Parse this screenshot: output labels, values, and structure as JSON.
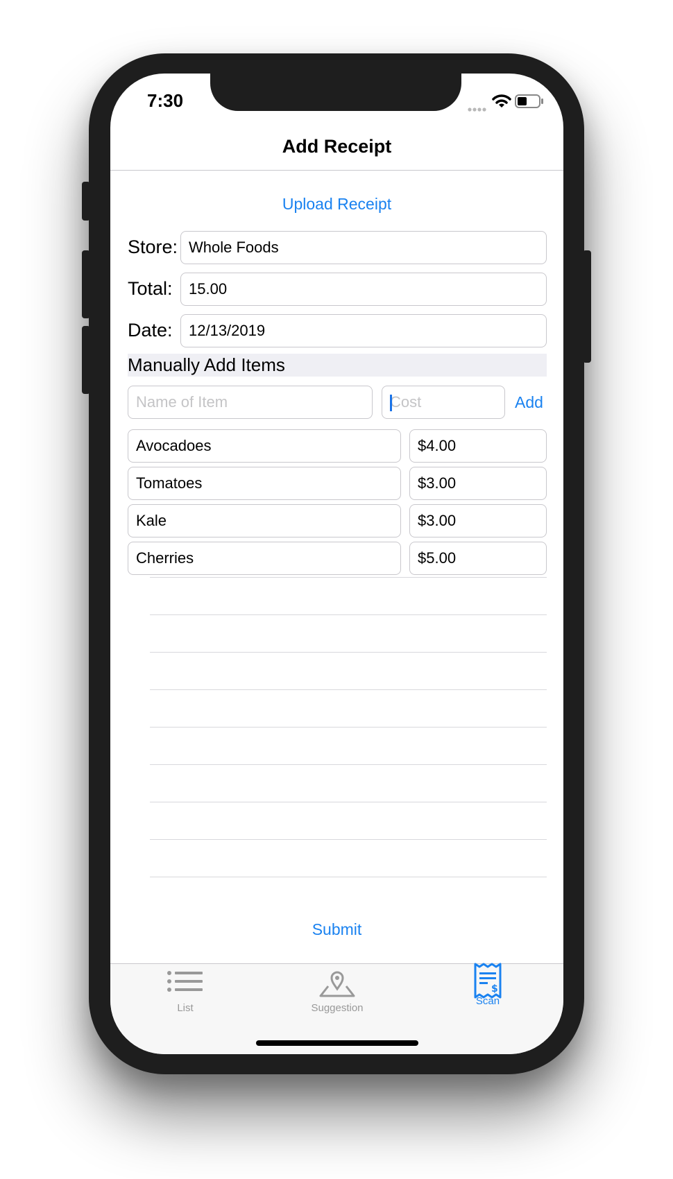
{
  "status_bar": {
    "time": "7:30"
  },
  "nav": {
    "title": "Add Receipt"
  },
  "upload_label": "Upload Receipt",
  "form": {
    "store": {
      "label": "Store:",
      "value": "Whole Foods"
    },
    "total": {
      "label": "Total:",
      "value": "15.00"
    },
    "date": {
      "label": "Date:",
      "value": "12/13/2019"
    }
  },
  "section_header": "Manually Add Items",
  "new_item": {
    "name_placeholder": "Name of Item",
    "cost_placeholder": "Cost",
    "add_label": "Add"
  },
  "items": [
    {
      "name": "Avocadoes",
      "cost": "$4.00"
    },
    {
      "name": "Tomatoes",
      "cost": "$3.00"
    },
    {
      "name": "Kale",
      "cost": "$3.00"
    },
    {
      "name": "Cherries",
      "cost": "$5.00"
    }
  ],
  "submit_label": "Submit",
  "tabs": [
    {
      "label": "List",
      "icon": "list-icon",
      "active": false
    },
    {
      "label": "Suggestion",
      "icon": "map-pin-icon",
      "active": false
    },
    {
      "label": "Scan",
      "icon": "receipt-icon",
      "active": true
    }
  ],
  "colors": {
    "accent": "#1a82f0",
    "inactive_tab": "#999999",
    "section_bg": "#efeff4"
  }
}
